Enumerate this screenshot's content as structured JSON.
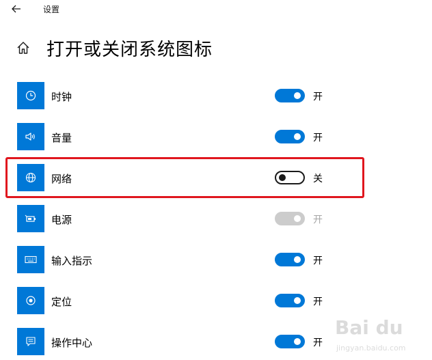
{
  "titlebar": {
    "title": "设置",
    "back_icon": "arrow-left-icon"
  },
  "header": {
    "home_icon": "home-icon",
    "title": "打开或关闭系统图标"
  },
  "colors": {
    "accent": "#0078d7",
    "highlight": "#e0161e",
    "disabled": "#cccccc"
  },
  "rows": [
    {
      "icon": "clock-icon",
      "label": "时钟",
      "state": "开",
      "on": true,
      "disabled": false
    },
    {
      "icon": "volume-icon",
      "label": "音量",
      "state": "开",
      "on": true,
      "disabled": false
    },
    {
      "icon": "globe-icon",
      "label": "网络",
      "state": "关",
      "on": false,
      "disabled": false,
      "highlighted": true
    },
    {
      "icon": "battery-icon",
      "label": "电源",
      "state": "开",
      "on": true,
      "disabled": true
    },
    {
      "icon": "keyboard-icon",
      "label": "输入指示",
      "state": "开",
      "on": true,
      "disabled": false
    },
    {
      "icon": "location-icon",
      "label": "定位",
      "state": "开",
      "on": true,
      "disabled": false
    },
    {
      "icon": "action-center-icon",
      "label": "操作中心",
      "state": "开",
      "on": true,
      "disabled": false
    }
  ],
  "watermark": {
    "logo": "Bai du",
    "url": "jingyan.baidu.com"
  }
}
